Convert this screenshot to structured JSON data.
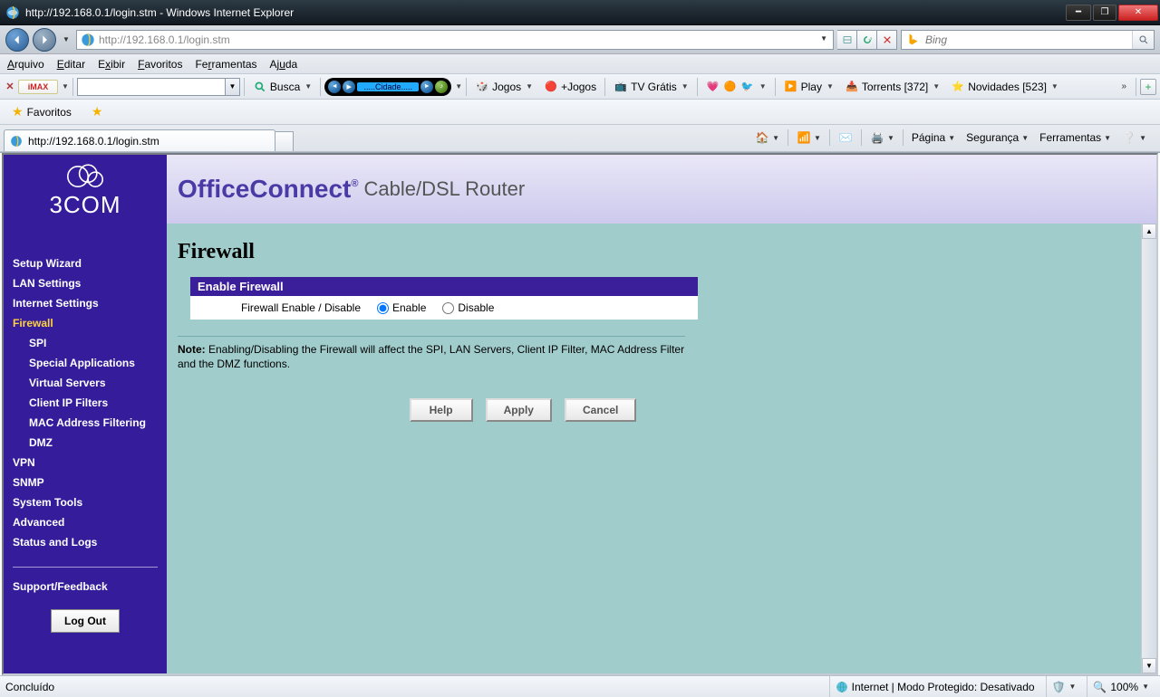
{
  "window": {
    "title": "http://192.168.0.1/login.stm - Windows Internet Explorer"
  },
  "addressbar": {
    "url": "http://192.168.0.1/login.stm"
  },
  "searchbox": {
    "placeholder": "Bing"
  },
  "menu": {
    "arquivo": "Arquivo",
    "editar": "Editar",
    "exibir": "Exibir",
    "favoritos": "Favoritos",
    "ferramentas": "Ferramentas",
    "ajuda": "Ajuda"
  },
  "linksbar": {
    "busca": "Busca",
    "media_label": ".....Cidade.....",
    "jogos": "Jogos",
    "mais_jogos": "+Jogos",
    "tv": "TV Grátis",
    "play": "Play",
    "torrents": "Torrents [372]",
    "novidades": "Novidades [523]"
  },
  "favbar": {
    "favoritos": "Favoritos"
  },
  "tab": {
    "title": "http://192.168.0.1/login.stm"
  },
  "cmdbar": {
    "pagina": "Página",
    "seguranca": "Segurança",
    "ferramentas": "Ferramentas"
  },
  "router": {
    "brand_logo": "3COM",
    "brand_main": "OfficeConnect",
    "brand_sub": "Cable/DSL Router",
    "page_title": "Firewall",
    "panel_head": "Enable Firewall",
    "field_label": "Firewall Enable / Disable",
    "opt_enable": "Enable",
    "opt_disable": "Disable",
    "note_prefix": "Note:",
    "note_body": " Enabling/Disabling the Firewall will affect the SPI, LAN Servers, Client IP Filter, MAC Address Filter and the DMZ functions.",
    "btn_help": "Help",
    "btn_apply": "Apply",
    "btn_cancel": "Cancel",
    "logout": "Log Out",
    "nav": {
      "setup": "Setup Wizard",
      "lan": "LAN Settings",
      "internet": "Internet Settings",
      "firewall": "Firewall",
      "spi": "SPI",
      "special": "Special Applications",
      "virtual": "Virtual Servers",
      "clientip": "Client IP Filters",
      "mac": "MAC Address Filtering",
      "dmz": "DMZ",
      "vpn": "VPN",
      "snmp": "SNMP",
      "tools": "System Tools",
      "advanced": "Advanced",
      "status": "Status and Logs",
      "support": "Support/Feedback"
    }
  },
  "statusbar": {
    "done": "Concluído",
    "zone": "Internet | Modo Protegido: Desativado",
    "zoom": "100%"
  }
}
